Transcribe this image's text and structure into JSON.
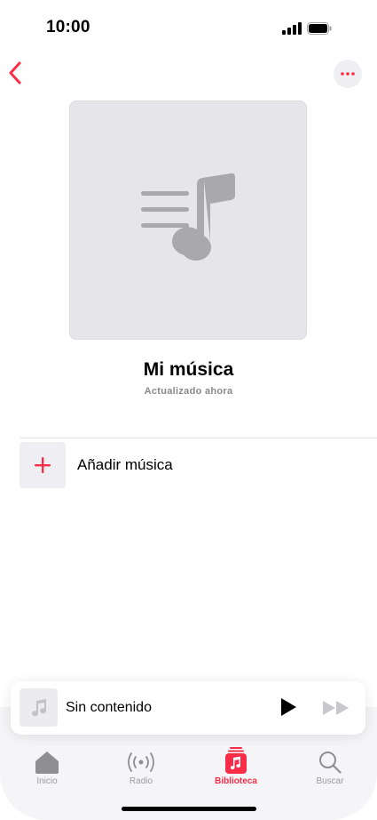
{
  "status_bar": {
    "time": "10:00"
  },
  "playlist": {
    "title": "Mi música",
    "updated": "Actualizado ahora"
  },
  "actions": {
    "add_music_label": "Añadir música"
  },
  "mini_player": {
    "title": "Sin contenido"
  },
  "tabs": [
    {
      "label": "Inicio",
      "icon": "home-icon",
      "active": false
    },
    {
      "label": "Radio",
      "icon": "radio-icon",
      "active": false
    },
    {
      "label": "Biblioteca",
      "icon": "library-icon",
      "active": true
    },
    {
      "label": "Buscar",
      "icon": "search-icon",
      "active": false
    }
  ],
  "colors": {
    "accent": "#fa2d48",
    "icon_gray": "#a0a0a5",
    "background": "#ffffff"
  }
}
